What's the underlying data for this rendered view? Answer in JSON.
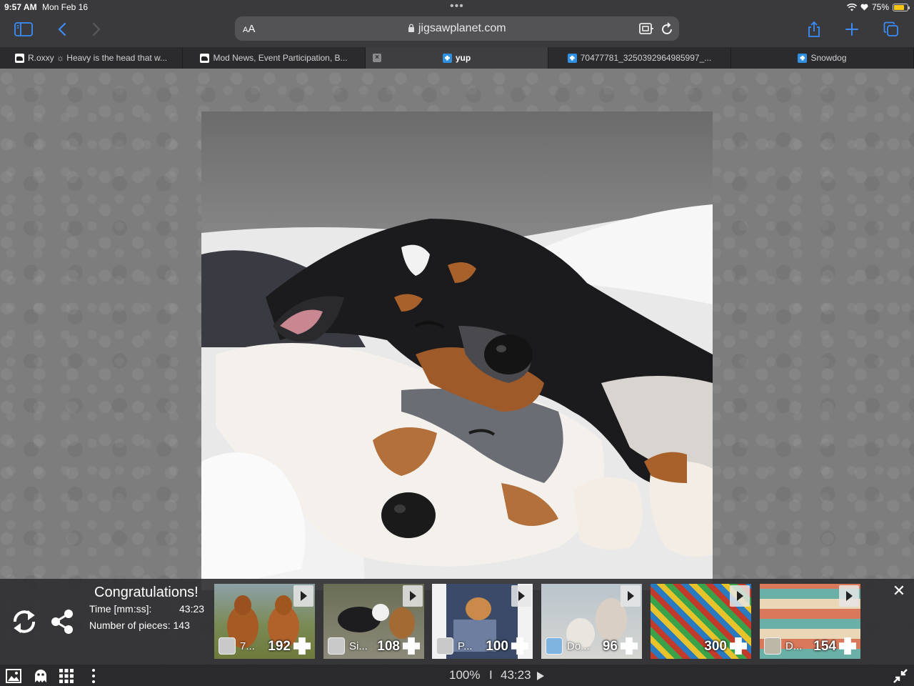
{
  "status_bar": {
    "time": "9:57 AM",
    "date": "Mon Feb 16",
    "battery_percent": "75%",
    "battery_level": 0.75,
    "icons": [
      "wifi-icon",
      "heart-icon",
      "battery-icon"
    ]
  },
  "browser": {
    "reader_label": "AA",
    "url": "jigsawplanet.com",
    "icons": [
      "sidebar-icon",
      "back-icon",
      "forward-icon",
      "lock-icon",
      "extension-icon",
      "reload-icon",
      "share-icon",
      "new-tab-icon",
      "tabs-overview-icon"
    ],
    "accent_color": "#3b8cf6"
  },
  "tabs": [
    {
      "label": "R.oxxy ☼ Heavy is the head that w...",
      "favicon": "dog-favicon",
      "active": false
    },
    {
      "label": "Mod News, Event Participation, B...",
      "favicon": "dog-favicon",
      "active": false
    },
    {
      "label": "yup",
      "favicon": "puzzle-favicon",
      "active": true
    },
    {
      "label": "70477781_3250392964985997_...",
      "favicon": "puzzle-favicon",
      "active": false
    },
    {
      "label": "Snowdog",
      "favicon": "puzzle-favicon",
      "active": false
    }
  ],
  "completion": {
    "title": "Congratulations!",
    "time_label": "Time [mm:ss]:",
    "time_value": "43:23",
    "pieces_label": "Number of pieces: 143",
    "icons": [
      "restart-icon",
      "share-icon",
      "close-icon"
    ]
  },
  "suggestions": [
    {
      "title": "7...",
      "pieces": "192",
      "theme": "two-brown-dogs"
    },
    {
      "title": "Si...",
      "pieces": "108",
      "theme": "dogs-on-path"
    },
    {
      "title": "P...",
      "pieces": "100",
      "theme": "dog-on-rug"
    },
    {
      "title": "Do...",
      "pieces": "96",
      "theme": "puppies-nose-to-nose"
    },
    {
      "title": "",
      "pieces": "300",
      "theme": "dog-collage"
    },
    {
      "title": "D...",
      "pieces": "154",
      "theme": "dog-grid-collage"
    }
  ],
  "bottom_bar": {
    "zoom": "100%",
    "separator": "I",
    "timer": "43:23",
    "icons": [
      "preview-image-icon",
      "ghost-image-icon",
      "arrange-grid-icon",
      "more-menu-icon",
      "play-icon",
      "exit-fullscreen-icon"
    ]
  }
}
